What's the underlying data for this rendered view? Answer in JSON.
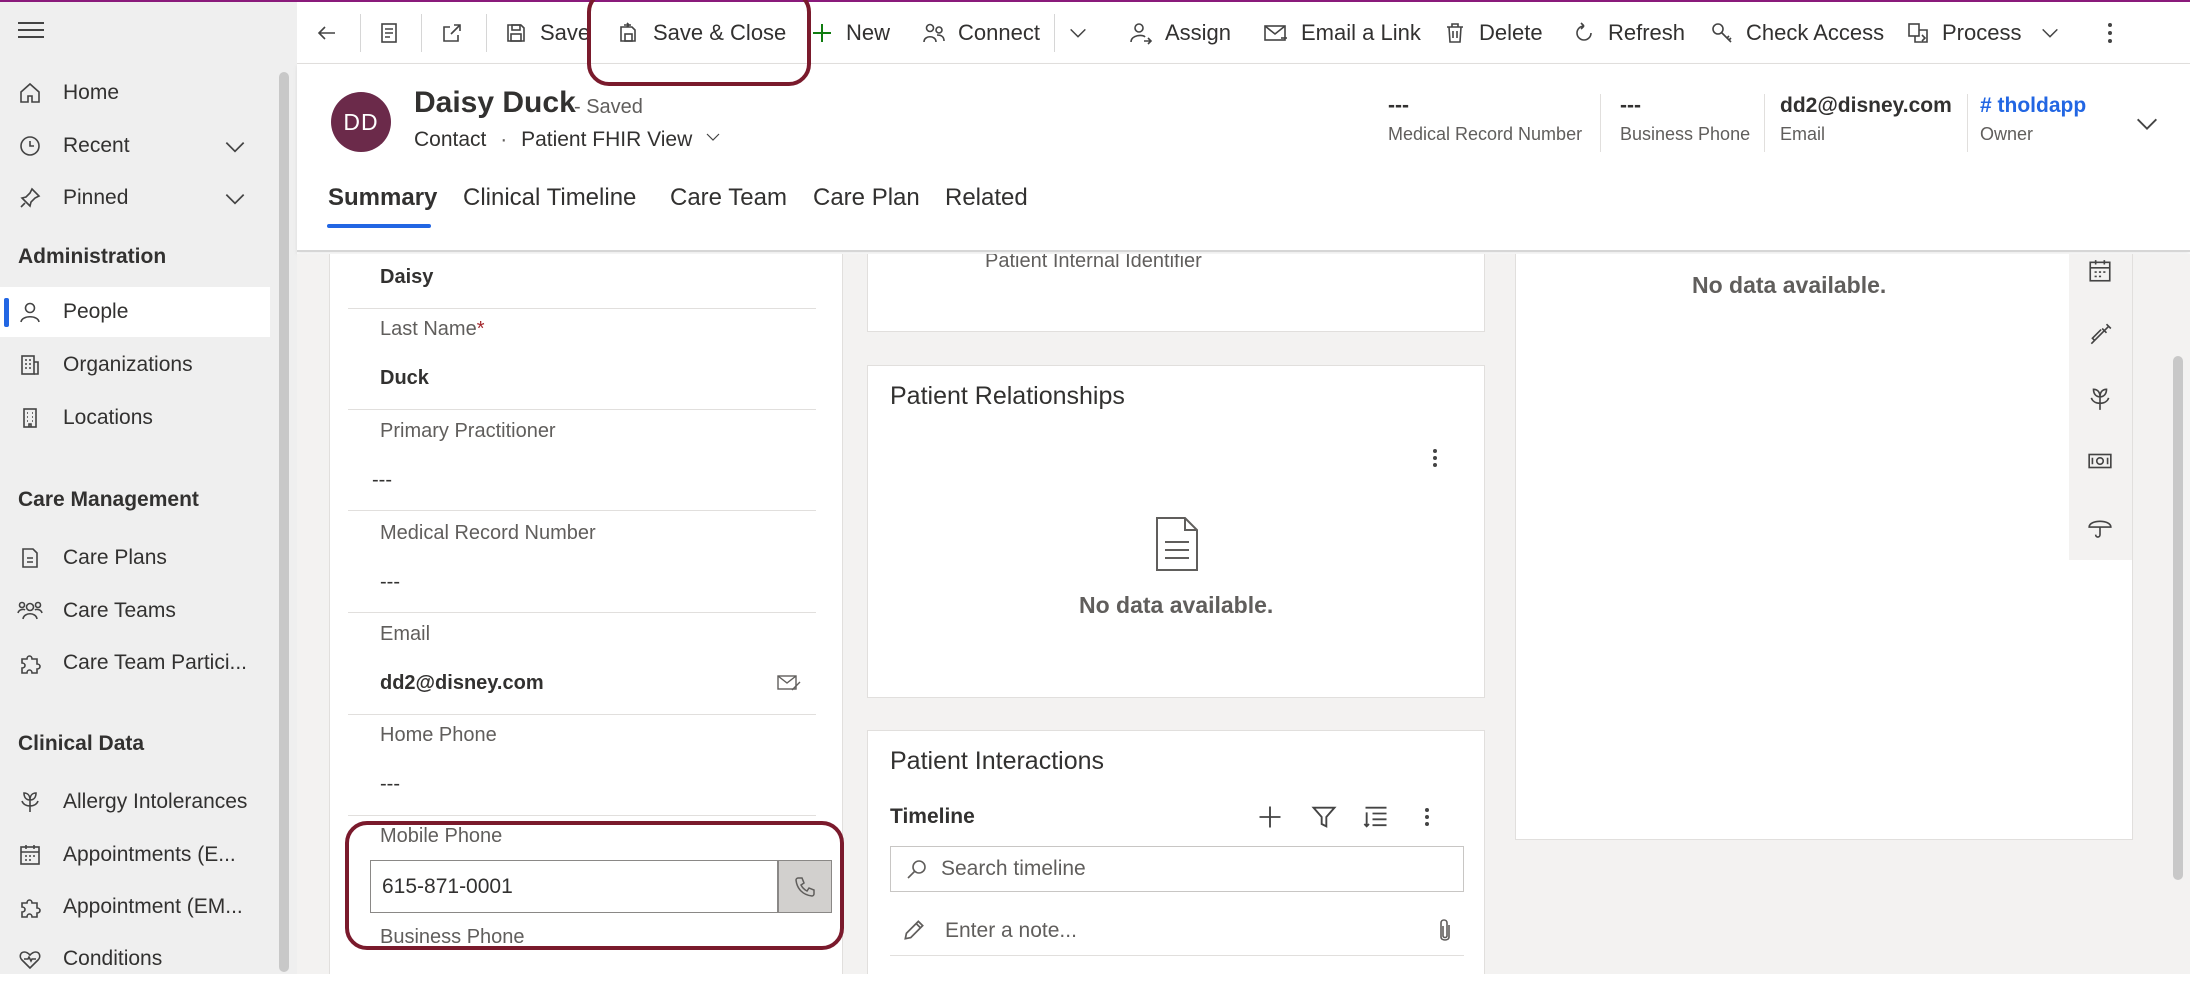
{
  "sidebar": {
    "items": [
      {
        "label": "Home"
      },
      {
        "label": "Recent"
      },
      {
        "label": "Pinned"
      }
    ],
    "sections": [
      {
        "title": "Administration",
        "items": [
          {
            "label": "People"
          },
          {
            "label": "Organizations"
          },
          {
            "label": "Locations"
          }
        ]
      },
      {
        "title": "Care Management",
        "items": [
          {
            "label": "Care Plans"
          },
          {
            "label": "Care Teams"
          },
          {
            "label": "Care Team Partici..."
          }
        ]
      },
      {
        "title": "Clinical Data",
        "items": [
          {
            "label": "Allergy Intolerances"
          },
          {
            "label": "Appointments (E..."
          },
          {
            "label": "Appointment (EM..."
          },
          {
            "label": "Conditions"
          }
        ]
      }
    ]
  },
  "commandbar": {
    "save": "Save",
    "save_close": "Save & Close",
    "new": "New",
    "connect": "Connect",
    "assign": "Assign",
    "email_link": "Email a Link",
    "delete": "Delete",
    "refresh": "Refresh",
    "check_access": "Check Access",
    "process": "Process"
  },
  "header": {
    "initials": "DD",
    "name": "Daisy Duck",
    "saved": "- Saved",
    "entity": "Contact",
    "dot": "·",
    "form": "Patient FHIR View",
    "fields": [
      {
        "value": "---",
        "label": "Medical Record Number"
      },
      {
        "value": "---",
        "label": "Business Phone"
      },
      {
        "value": "dd2@disney.com",
        "label": "Email"
      },
      {
        "value": "# tholdapp",
        "label": "Owner"
      }
    ],
    "tabs": [
      "Summary",
      "Clinical Timeline",
      "Care Team",
      "Care Plan",
      "Related"
    ]
  },
  "form": {
    "first_name_value": "Daisy",
    "last_name_label": "Last Name",
    "last_name_required": "*",
    "last_name_value": "Duck",
    "primary_practitioner_label": "Primary Practitioner",
    "primary_practitioner_value": "---",
    "mrn_label": "Medical Record Number",
    "mrn_value": "---",
    "email_label": "Email",
    "email_value": "dd2@disney.com",
    "home_phone_label": "Home Phone",
    "home_phone_value": "---",
    "mobile_phone_label": "Mobile Phone",
    "mobile_phone_value": "615-871-0001",
    "business_phone_label": "Business Phone"
  },
  "middle": {
    "internal_id_label": "Patient Internal Identifier",
    "relationships_title": "Patient Relationships",
    "relationships_empty": "No data available.",
    "interactions_title": "Patient Interactions",
    "timeline_label": "Timeline",
    "search_placeholder": "Search timeline",
    "note_placeholder": "Enter a note..."
  },
  "right": {
    "empty": "No data available."
  }
}
